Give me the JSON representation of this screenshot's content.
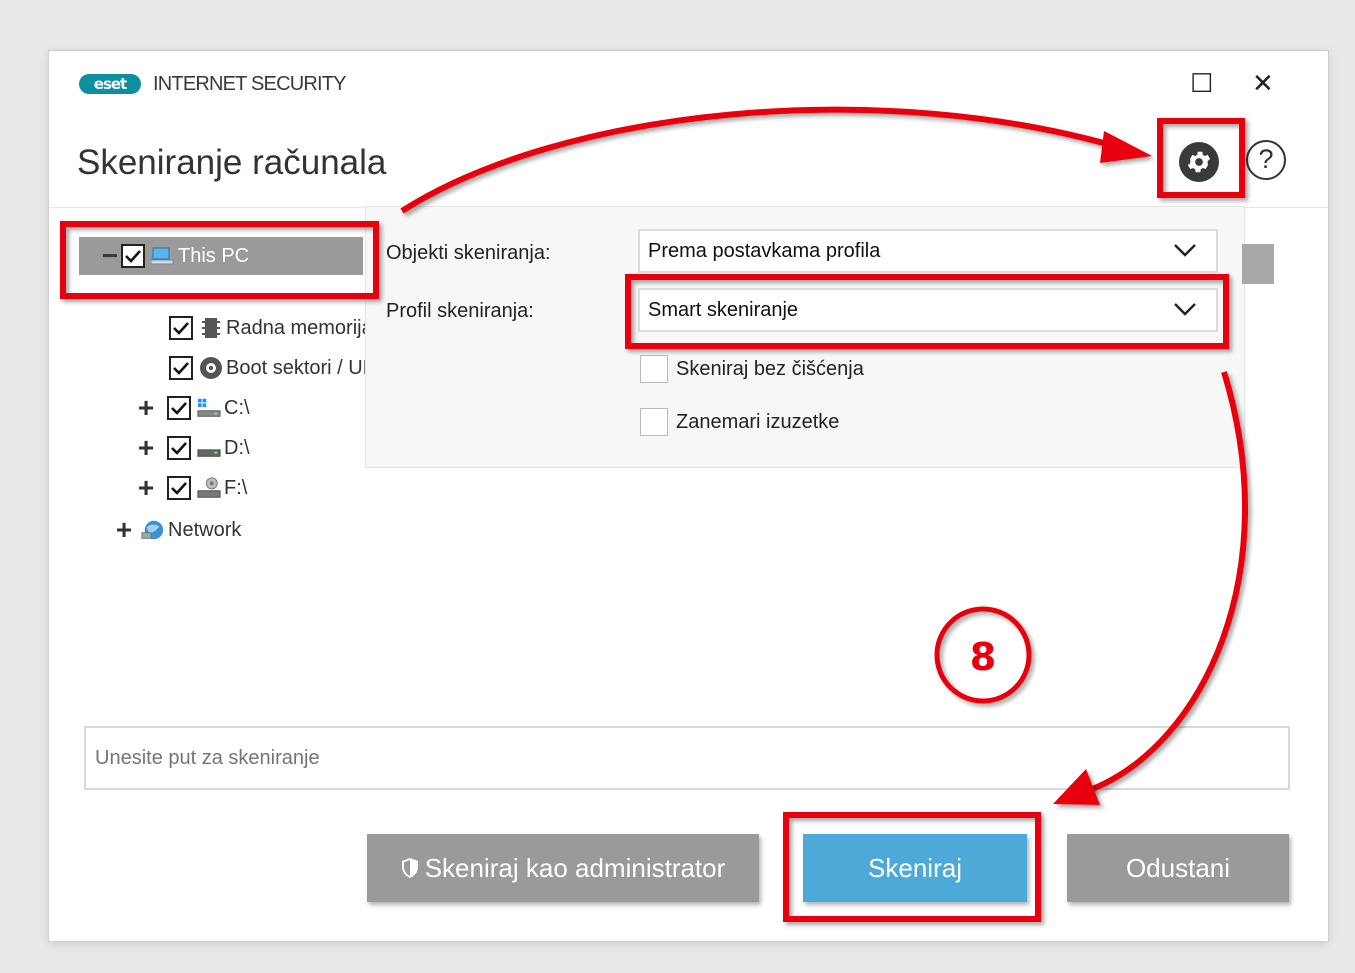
{
  "window": {
    "logo_text": "eset",
    "product_name": "INTERNET SECURITY",
    "page_title": "Skeniranje računala",
    "controls": {
      "maximize": "☐",
      "close": "✕"
    }
  },
  "header_icons": {
    "settings": "gear-icon",
    "help": "?"
  },
  "tree": {
    "items": [
      {
        "label": "This PC",
        "icon": "computer-icon",
        "expander": "−",
        "checked": true,
        "selected": true
      },
      {
        "label": "Radna memorija",
        "icon": "chip-icon",
        "checked": true
      },
      {
        "label": "Boot sektori / UEFI",
        "icon": "disc-icon",
        "checked": true
      },
      {
        "label": "C:\\",
        "icon": "windows-drive-icon",
        "expander": "+",
        "checked": true
      },
      {
        "label": "D:\\",
        "icon": "drive-icon",
        "expander": "+",
        "checked": true
      },
      {
        "label": "F:\\",
        "icon": "network-drive-icon",
        "expander": "+",
        "checked": true
      },
      {
        "label": "Network",
        "icon": "network-globe-icon",
        "expander": "+"
      }
    ]
  },
  "settings": {
    "targets_label": "Objekti skeniranja:",
    "targets_value": "Prema postavkama profila",
    "profile_label": "Profil skeniranja:",
    "profile_value": "Smart skeniranje",
    "options": [
      {
        "label": "Skeniraj bez čišćenja",
        "checked": false
      },
      {
        "label": "Zanemari izuzetke",
        "checked": false
      }
    ]
  },
  "path_input": {
    "placeholder": "Unesite put za skeniranje",
    "value": ""
  },
  "buttons": {
    "scan_admin": "Skeniraj kao administrator",
    "scan": "Skeniraj",
    "cancel": "Odustani"
  },
  "annotation": {
    "step_number": "8",
    "highlight_color": "#e8000d"
  }
}
